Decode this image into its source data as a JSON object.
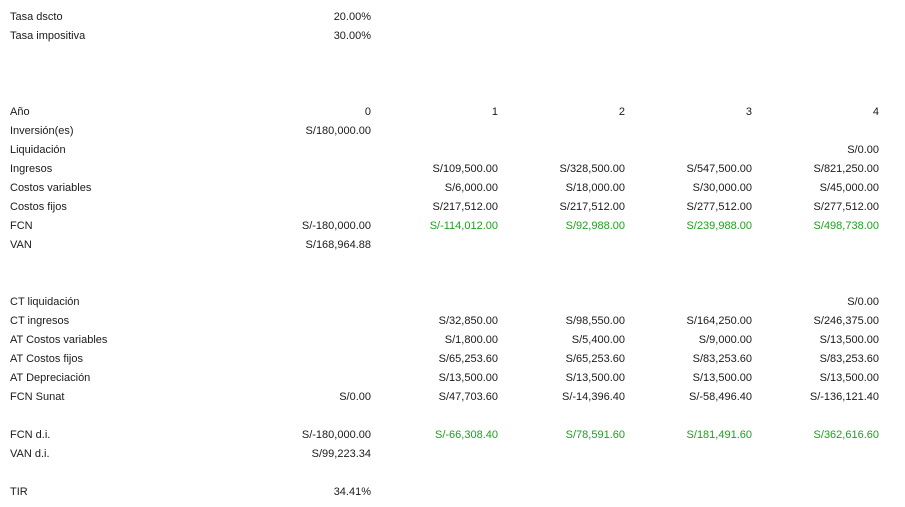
{
  "params": {
    "tasa_dscto": {
      "label": "Tasa dscto",
      "value": "20.00%"
    },
    "tasa_impositiva": {
      "label": "Tasa impositiva",
      "value": "30.00%"
    }
  },
  "cash_flow": {
    "anio": {
      "label": "Año",
      "values": [
        "0",
        "1",
        "2",
        "3",
        "4"
      ]
    },
    "inversion": {
      "label": "Inversión(es)",
      "values": [
        "S/180,000.00",
        "",
        "",
        "",
        ""
      ]
    },
    "liquidacion": {
      "label": "Liquidación",
      "values": [
        "",
        "",
        "",
        "",
        "S/0.00"
      ]
    },
    "ingresos": {
      "label": "Ingresos",
      "values": [
        "",
        "S/109,500.00",
        "S/328,500.00",
        "S/547,500.00",
        "S/821,250.00"
      ]
    },
    "costos_variables": {
      "label": "Costos variables",
      "values": [
        "",
        "S/6,000.00",
        "S/18,000.00",
        "S/30,000.00",
        "S/45,000.00"
      ]
    },
    "costos_fijos": {
      "label": "Costos fijos",
      "values": [
        "",
        "S/217,512.00",
        "S/217,512.00",
        "S/277,512.00",
        "S/277,512.00"
      ]
    },
    "fcn": {
      "label": "FCN",
      "values": [
        "S/-180,000.00",
        "S/-114,012.00",
        "S/92,988.00",
        "S/239,988.00",
        "S/498,738.00"
      ]
    },
    "van": {
      "label": "VAN",
      "values": [
        "S/168,964.88",
        "",
        "",
        "",
        ""
      ]
    }
  },
  "tax": {
    "ct_liquidacion": {
      "label": "CT liquidación",
      "values": [
        "",
        "",
        "",
        "",
        "S/0.00"
      ]
    },
    "ct_ingresos": {
      "label": "CT ingresos",
      "values": [
        "",
        "S/32,850.00",
        "S/98,550.00",
        "S/164,250.00",
        "S/246,375.00"
      ]
    },
    "at_costos_variables": {
      "label": "AT Costos variables",
      "values": [
        "",
        "S/1,800.00",
        "S/5,400.00",
        "S/9,000.00",
        "S/13,500.00"
      ]
    },
    "at_costos_fijos": {
      "label": "AT Costos fijos",
      "values": [
        "",
        "S/65,253.60",
        "S/65,253.60",
        "S/83,253.60",
        "S/83,253.60"
      ]
    },
    "at_depreciacion": {
      "label": "AT Depreciación",
      "values": [
        "",
        "S/13,500.00",
        "S/13,500.00",
        "S/13,500.00",
        "S/13,500.00"
      ]
    },
    "fcn_sunat": {
      "label": "FCN Sunat",
      "values": [
        "S/0.00",
        "S/47,703.60",
        "S/-14,396.40",
        "S/-58,496.40",
        "S/-136,121.40"
      ]
    }
  },
  "after_tax": {
    "fcn_di": {
      "label": "FCN d.i.",
      "values": [
        "S/-180,000.00",
        "S/-66,308.40",
        "S/78,591.60",
        "S/181,491.60",
        "S/362,616.60"
      ]
    },
    "van_di": {
      "label": "VAN d.i.",
      "values": [
        "S/99,223.34",
        "",
        "",
        "",
        ""
      ]
    }
  },
  "tir": {
    "label": "TIR",
    "value": "34.41%"
  },
  "colors": {
    "positive_highlight": "#1aa31a",
    "text": "#1a1a1a",
    "background": "#ffffff"
  }
}
